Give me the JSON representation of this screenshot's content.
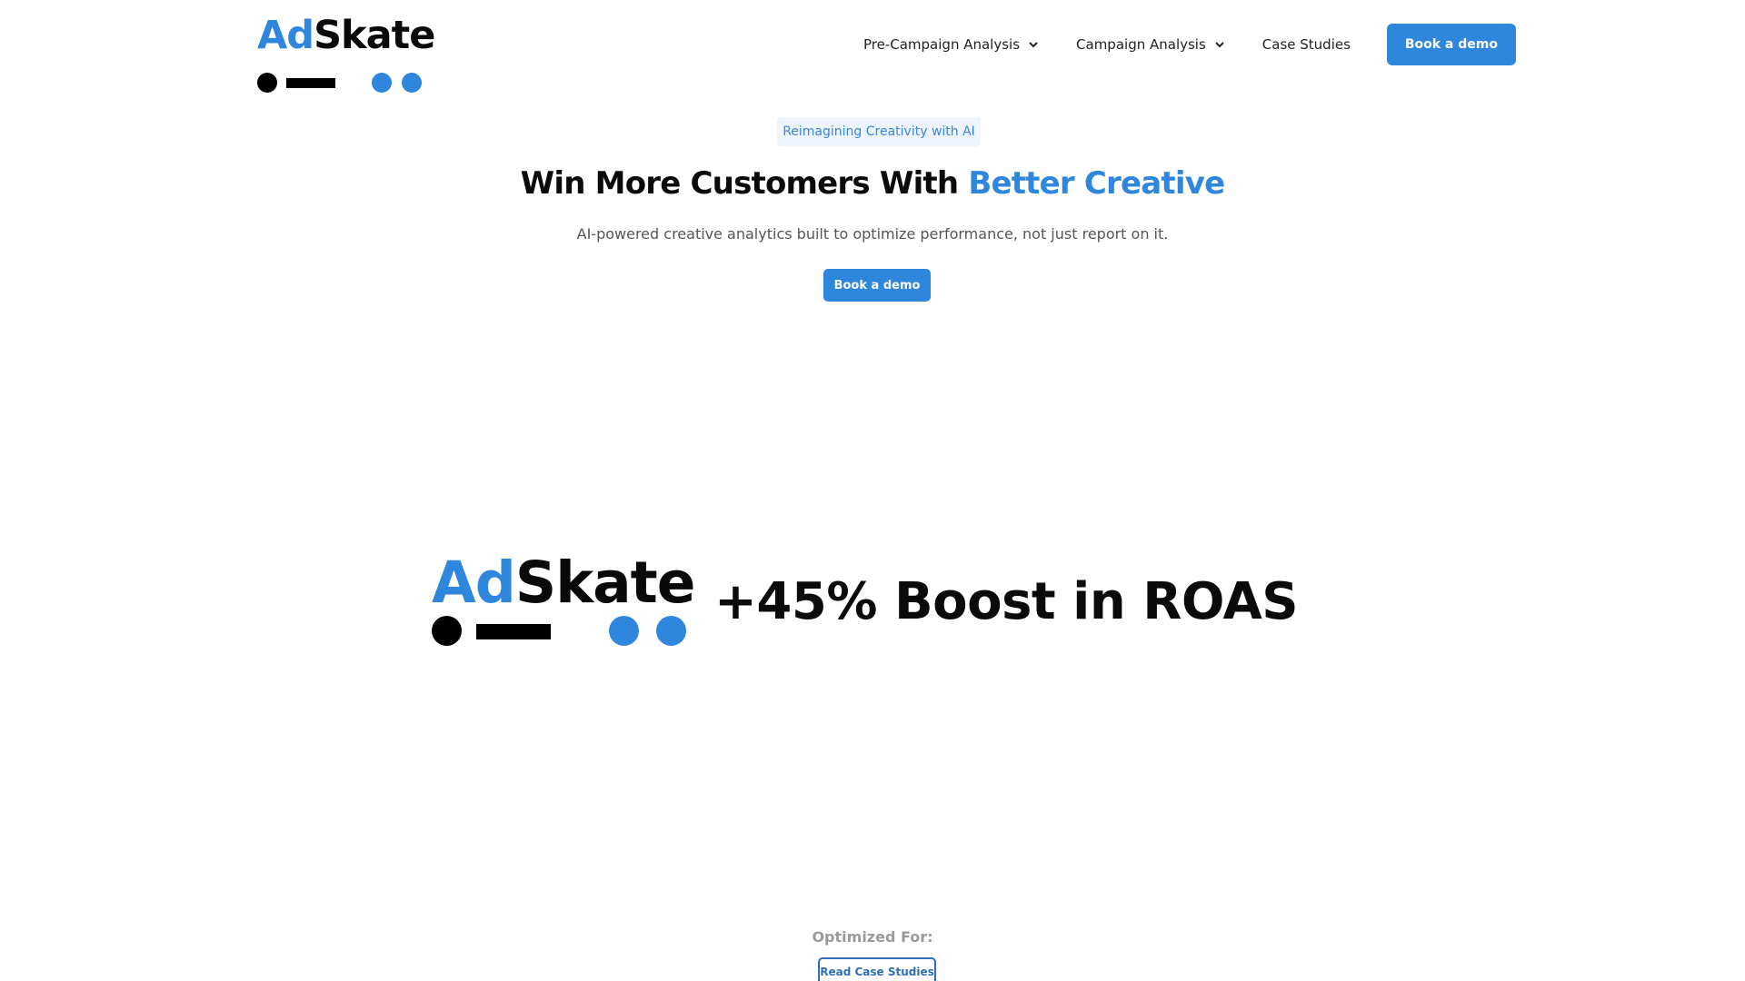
{
  "brand": {
    "name_part1": "Ad",
    "name_part2": "Skate",
    "colors": {
      "accent": "#2f86dd",
      "dark": "#0a0a0a"
    }
  },
  "nav": {
    "items": [
      {
        "label": "Pre-Campaign Analysis",
        "icon": "chevron-down-icon"
      },
      {
        "label": "Campaign Analysis",
        "icon": "chevron-down-icon"
      },
      {
        "label": "Case Studies"
      }
    ],
    "cta_label": "Book a demo"
  },
  "hero": {
    "badge": "Reimagining Creativity with AI",
    "headline_main": "Win More Customers With ",
    "headline_accent": "Better Creative",
    "subtitle": "AI-powered creative analytics built to optimize performance, not just report on it.",
    "cta_label": "Book a demo"
  },
  "showcase": {
    "stat": "+45% Boost in ROAS"
  },
  "footer_strip": {
    "label": "Optimized For:",
    "button_label": "Read Case Studies"
  }
}
